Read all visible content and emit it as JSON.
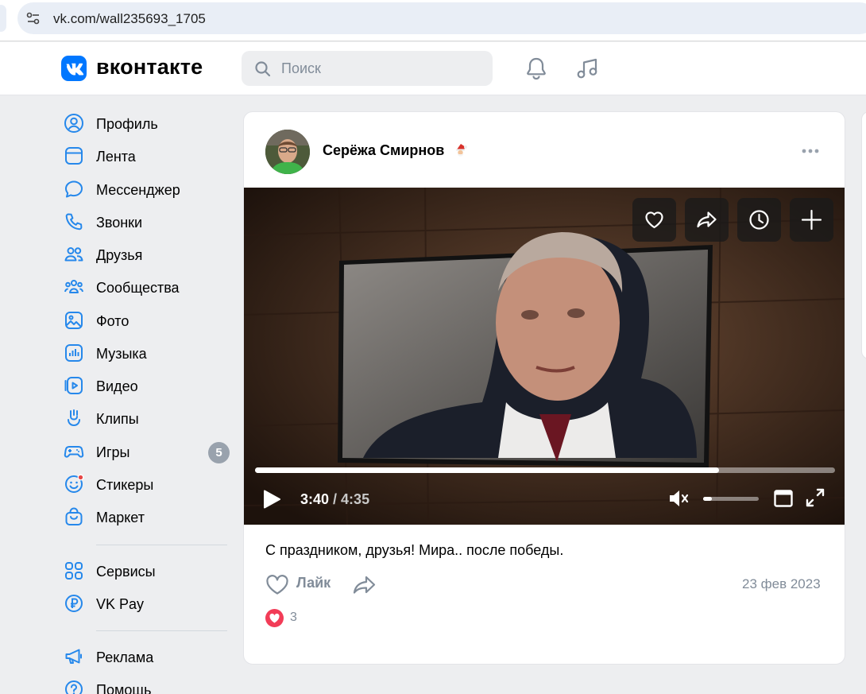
{
  "browser": {
    "url": "vk.com/wall235693_1705"
  },
  "header": {
    "logo_text": "вконтакте",
    "search_placeholder": "Поиск",
    "accent_color": "#0077ff"
  },
  "sidebar": {
    "items": [
      {
        "label": "Профиль",
        "icon": "profile-icon"
      },
      {
        "label": "Лента",
        "icon": "news-icon"
      },
      {
        "label": "Мессенджер",
        "icon": "messenger-icon"
      },
      {
        "label": "Звонки",
        "icon": "phone-icon"
      },
      {
        "label": "Друзья",
        "icon": "friends-icon"
      },
      {
        "label": "Сообщества",
        "icon": "communities-icon"
      },
      {
        "label": "Фото",
        "icon": "photo-icon"
      },
      {
        "label": "Музыка",
        "icon": "music-icon"
      },
      {
        "label": "Видео",
        "icon": "video-icon"
      },
      {
        "label": "Клипы",
        "icon": "clips-icon"
      },
      {
        "label": "Игры",
        "icon": "games-icon",
        "badge": "5"
      },
      {
        "label": "Стикеры",
        "icon": "stickers-icon"
      },
      {
        "label": "Маркет",
        "icon": "market-icon"
      }
    ],
    "extra": [
      {
        "label": "Сервисы",
        "icon": "services-icon"
      },
      {
        "label": "VK Pay",
        "icon": "vkpay-icon"
      }
    ],
    "bottom": [
      {
        "label": "Реклама",
        "icon": "ads-icon"
      },
      {
        "label": "Помощь",
        "icon": "help-icon"
      }
    ]
  },
  "post": {
    "author": "Серёжа Смирнов",
    "text": "С праздником, друзья! Мира.. после победы.",
    "like_label": "Лайк",
    "date": "23 фев 2023",
    "reactions_count": "3",
    "video": {
      "current_time": "3:40",
      "separator": " / ",
      "duration": "4:35",
      "progress": 0.8,
      "volume": 0.15
    }
  }
}
